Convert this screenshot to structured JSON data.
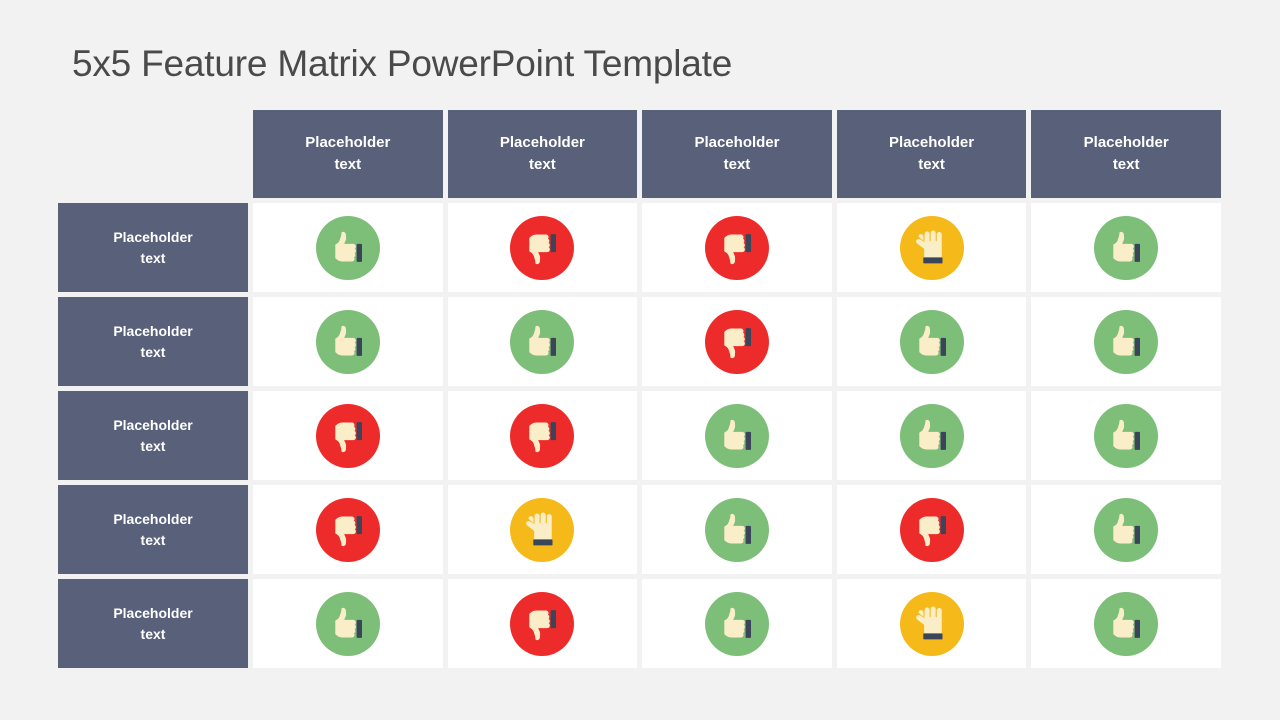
{
  "page": {
    "title": "5x5 Feature Matrix PowerPoint Template",
    "background_color": "#f2f2f2",
    "title_color": "#4a4a4a"
  },
  "palette": {
    "header_blue": "#58607a",
    "positive_green": "#7dbe79",
    "negative_red": "#ee2b2b",
    "neutral_amber": "#f5b919",
    "cell_white": "#ffffff",
    "hand_cream": "#faeec8",
    "cuff_navy": "#3b4559"
  },
  "matrix": {
    "corner_label": "",
    "column_headers": [
      {
        "label": "Placeholder text",
        "line1": "Placeholder",
        "line2": "text"
      },
      {
        "label": "Placeholder text",
        "line1": "Placeholder",
        "line2": "text"
      },
      {
        "label": "Placeholder text",
        "line1": "Placeholder",
        "line2": "text"
      },
      {
        "label": "Placeholder text",
        "line1": "Placeholder",
        "line2": "text"
      },
      {
        "label": "Placeholder text",
        "line1": "Placeholder",
        "line2": "text"
      }
    ],
    "rows": [
      {
        "header": {
          "label": "Placeholder text",
          "line1": "Placeholder",
          "line2": "text"
        },
        "cells": [
          {
            "icon": "thumbs-up-icon",
            "status": "positive",
            "color": "#7dbe79"
          },
          {
            "icon": "thumbs-down-icon",
            "status": "negative",
            "color": "#ee2b2b"
          },
          {
            "icon": "thumbs-down-icon",
            "status": "negative",
            "color": "#ee2b2b"
          },
          {
            "icon": "flat-hand-icon",
            "status": "neutral",
            "color": "#f5b919"
          },
          {
            "icon": "thumbs-up-icon",
            "status": "positive",
            "color": "#7dbe79"
          }
        ]
      },
      {
        "header": {
          "label": "Placeholder text",
          "line1": "Placeholder",
          "line2": "text"
        },
        "cells": [
          {
            "icon": "thumbs-up-icon",
            "status": "positive",
            "color": "#7dbe79"
          },
          {
            "icon": "thumbs-up-icon",
            "status": "positive",
            "color": "#7dbe79"
          },
          {
            "icon": "thumbs-down-icon",
            "status": "negative",
            "color": "#ee2b2b"
          },
          {
            "icon": "thumbs-up-icon",
            "status": "positive",
            "color": "#7dbe79"
          },
          {
            "icon": "thumbs-up-icon",
            "status": "positive",
            "color": "#7dbe79"
          }
        ]
      },
      {
        "header": {
          "label": "Placeholder text",
          "line1": "Placeholder",
          "line2": "text"
        },
        "cells": [
          {
            "icon": "thumbs-down-icon",
            "status": "negative",
            "color": "#ee2b2b"
          },
          {
            "icon": "thumbs-down-icon",
            "status": "negative",
            "color": "#ee2b2b"
          },
          {
            "icon": "thumbs-up-icon",
            "status": "positive",
            "color": "#7dbe79"
          },
          {
            "icon": "thumbs-up-icon",
            "status": "positive",
            "color": "#7dbe79"
          },
          {
            "icon": "thumbs-up-icon",
            "status": "positive",
            "color": "#7dbe79"
          }
        ]
      },
      {
        "header": {
          "label": "Placeholder text",
          "line1": "Placeholder",
          "line2": "text"
        },
        "cells": [
          {
            "icon": "thumbs-down-icon",
            "status": "negative",
            "color": "#ee2b2b"
          },
          {
            "icon": "flat-hand-icon",
            "status": "neutral",
            "color": "#f5b919"
          },
          {
            "icon": "thumbs-up-icon",
            "status": "positive",
            "color": "#7dbe79"
          },
          {
            "icon": "thumbs-down-icon",
            "status": "negative",
            "color": "#ee2b2b"
          },
          {
            "icon": "thumbs-up-icon",
            "status": "positive",
            "color": "#7dbe79"
          }
        ]
      },
      {
        "header": {
          "label": "Placeholder text",
          "line1": "Placeholder",
          "line2": "text"
        },
        "cells": [
          {
            "icon": "thumbs-up-icon",
            "status": "positive",
            "color": "#7dbe79"
          },
          {
            "icon": "thumbs-down-icon",
            "status": "negative",
            "color": "#ee2b2b"
          },
          {
            "icon": "thumbs-up-icon",
            "status": "positive",
            "color": "#7dbe79"
          },
          {
            "icon": "flat-hand-icon",
            "status": "neutral",
            "color": "#f5b919"
          },
          {
            "icon": "thumbs-up-icon",
            "status": "positive",
            "color": "#7dbe79"
          }
        ]
      }
    ]
  }
}
